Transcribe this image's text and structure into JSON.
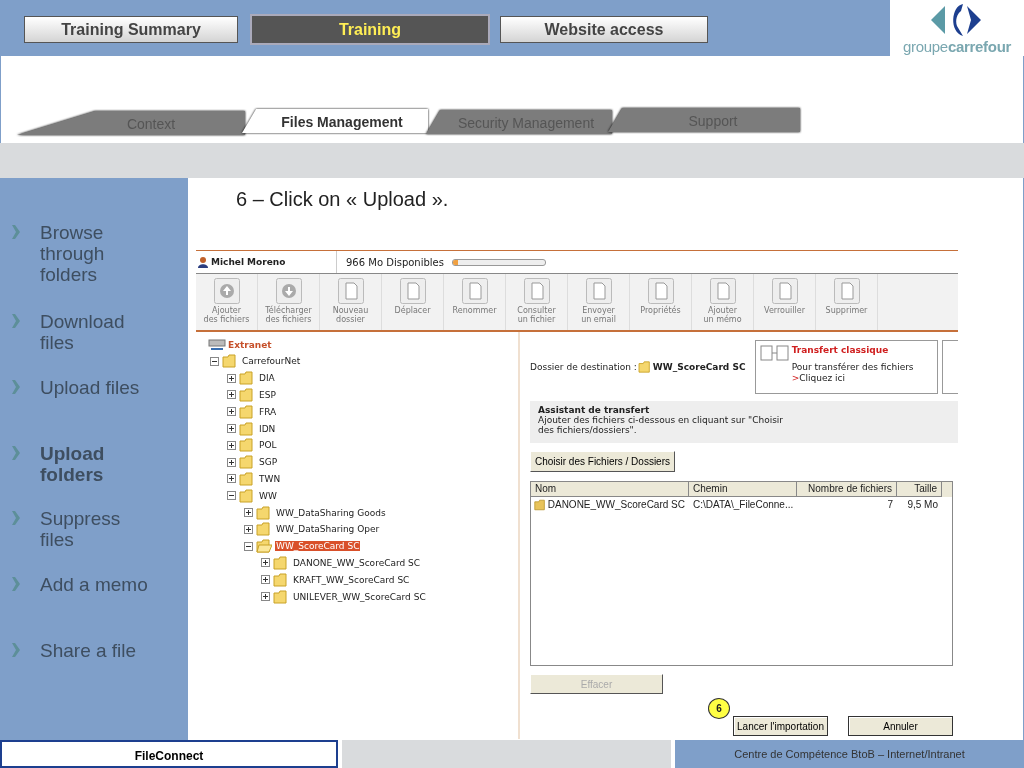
{
  "nav_tabs": [
    {
      "label": "Training Summary",
      "selected": false
    },
    {
      "label": "Training",
      "selected": true
    },
    {
      "label": "Website access",
      "selected": false
    }
  ],
  "logo": {
    "text": "groupe**carrefour**"
  },
  "sub_tabs": [
    {
      "label": "Context",
      "selected": false
    },
    {
      "label": "Files Management",
      "selected": true
    },
    {
      "label": "Security Management",
      "selected": false
    },
    {
      "label": "Support",
      "selected": false
    }
  ],
  "sidebar": {
    "items": [
      {
        "label": "Browse through folders",
        "selected": false
      },
      {
        "label": "Download files",
        "selected": false
      },
      {
        "label": "Upload files",
        "selected": false
      },
      {
        "label": "Upload folders",
        "selected": true
      },
      {
        "label": "Suppress files",
        "selected": false
      },
      {
        "label": "Add a memo",
        "selected": false
      },
      {
        "label": "Share a file",
        "selected": false
      }
    ]
  },
  "step_title": "6 – Click on « Upload ».",
  "app": {
    "user": "Michel Moreno",
    "quota": {
      "text": "966 Mo Disponibles",
      "level": 0.06
    },
    "toolbar": [
      {
        "lines": [
          "Ajouter",
          "des fichiers"
        ]
      },
      {
        "lines": [
          "Télécharger",
          "des fichiers"
        ]
      },
      {
        "lines": [
          "Nouveau",
          "dossier"
        ]
      },
      {
        "lines": [
          "Déplacer"
        ]
      },
      {
        "lines": [
          "Renommer"
        ]
      },
      {
        "lines": [
          "Consulter",
          "un fichier"
        ]
      },
      {
        "lines": [
          "Envoyer",
          "un email"
        ]
      },
      {
        "lines": [
          "Propriétés"
        ]
      },
      {
        "lines": [
          "Ajouter",
          "un mémo"
        ]
      },
      {
        "lines": [
          "Verrouiller"
        ]
      },
      {
        "lines": [
          "Supprimer"
        ]
      }
    ],
    "tree": {
      "root": "Extranet",
      "items": [
        {
          "label": "CarrefourNet",
          "expanded": true,
          "selected": false,
          "children": [
            {
              "label": "DIA",
              "expanded": false,
              "selected": false
            },
            {
              "label": "ESP",
              "expanded": false,
              "selected": false
            },
            {
              "label": "FRA",
              "expanded": false,
              "selected": false
            },
            {
              "label": "IDN",
              "expanded": false,
              "selected": false
            },
            {
              "label": "POL",
              "expanded": false,
              "selected": false
            },
            {
              "label": "SGP",
              "expanded": false,
              "selected": false
            },
            {
              "label": "TWN",
              "expanded": false,
              "selected": false
            },
            {
              "label": "WW",
              "expanded": true,
              "selected": false,
              "children": [
                {
                  "label": "WW_DataSharing Goods",
                  "expanded": false,
                  "selected": false
                },
                {
                  "label": "WW_DataSharing Oper",
                  "expanded": false,
                  "selected": false
                },
                {
                  "label": "WW_ScoreCard SC",
                  "expanded": true,
                  "selected": true,
                  "children": [
                    {
                      "label": "DANONE_WW_ScoreCard SC",
                      "expanded": false,
                      "selected": false
                    },
                    {
                      "label": "KRAFT_WW_ScoreCard SC",
                      "expanded": false,
                      "selected": false
                    },
                    {
                      "label": "UNILEVER_WW_ScoreCard SC",
                      "expanded": false,
                      "selected": false
                    }
                  ]
                }
              ]
            }
          ]
        }
      ]
    },
    "destination": {
      "label": "Dossier de destination :",
      "folder": "WW_ScoreCard SC"
    },
    "transfer_card": {
      "title": "Transfert classique",
      "text": "Pour transférer des fichiers",
      "link_mark": ">",
      "link": "Cliquez ici"
    },
    "assistant": {
      "title": "Assistant de transfert",
      "text": "Ajouter des fichiers ci-dessous en cliquant sur \"Choisir des fichiers/dossiers\"."
    },
    "choose_button": "Choisir des Fichiers / Dossiers",
    "table": {
      "columns": [
        "Nom",
        "Chemin",
        "Nombre de fichiers",
        "Taille"
      ],
      "rows": [
        [
          "DANONE_WW_ScoreCard SC",
          "C:\\DATA\\_FileConne...",
          "7",
          "9,5 Mo"
        ]
      ]
    },
    "clear_button": {
      "label": "Effacer",
      "disabled": true
    },
    "callout": "6",
    "buttons": [
      "Lancer l'importation",
      "Annuler"
    ]
  },
  "footer": {
    "left": "FileConnect",
    "right": "Centre de Compétence BtoB – Internet/Intranet"
  }
}
